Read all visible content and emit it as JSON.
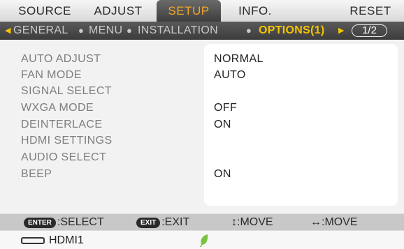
{
  "tabs": [
    "SOURCE",
    "ADJUST",
    "SETUP",
    "INFO.",
    "RESET"
  ],
  "subtabs": [
    "GENERAL",
    "MENU",
    "INSTALLATION",
    "OPTIONS(1)"
  ],
  "page_indicator": "1/2",
  "rows": [
    {
      "label": "AUTO ADJUST",
      "value": "NORMAL"
    },
    {
      "label": "FAN MODE",
      "value": "AUTO"
    },
    {
      "label": "SIGNAL SELECT",
      "value": ""
    },
    {
      "label": "WXGA MODE",
      "value": "OFF"
    },
    {
      "label": "DEINTERLACE",
      "value": "ON"
    },
    {
      "label": "HDMI SETTINGS",
      "value": ""
    },
    {
      "label": "AUDIO SELECT",
      "value": ""
    },
    {
      "label": "BEEP",
      "value": "ON"
    }
  ],
  "hints": {
    "enter_key": "ENTER",
    "enter_label": ":SELECT",
    "exit_key": "EXIT",
    "exit_label": ":EXIT",
    "move_v": "↕:MOVE",
    "move_h": "↔:MOVE"
  },
  "status": {
    "input": "HDMI1"
  },
  "colors": {
    "active_tab": "#f6a723",
    "active_subtab": "#f6c400",
    "subbar": "#4a4a4a"
  },
  "icons": [
    "hdmi-port-icon",
    "eco-leaf-icon",
    "arrow-left-icon",
    "arrow-right-icon"
  ]
}
